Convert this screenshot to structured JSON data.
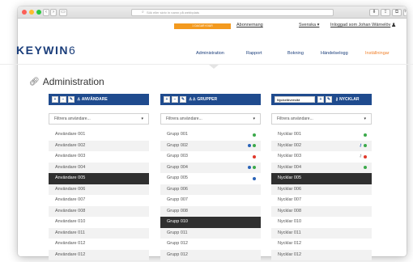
{
  "browser": {
    "url": "Sök eller skriv in namn på webbplats"
  },
  "topbar": {
    "cta": "1 DAGAR KVAR",
    "subscription": "Abonnemang",
    "language": "Svenska ▾",
    "logged_in": "Inloggad som Johan Wärnelöv"
  },
  "brand": {
    "logo_main": "KEYWIN",
    "logo_suffix": "6"
  },
  "nav": {
    "items": [
      {
        "label": "Administration"
      },
      {
        "label": "Rapport"
      },
      {
        "label": "Bokning"
      },
      {
        "label": "Händelselogg"
      },
      {
        "label": "Inställningar"
      }
    ]
  },
  "page": {
    "title": "Administration"
  },
  "users": {
    "title": "ANVÄNDARE",
    "filter_placeholder": "Filtrera användare...",
    "items": [
      "Användare 001",
      "Användare 002",
      "Användare 003",
      "Användare 004",
      "Användare 005",
      "Användare 006",
      "Användare 007",
      "Användare 008",
      "Användare 010",
      "Användare 011",
      "Användare 012",
      "Användare 012"
    ]
  },
  "groups": {
    "title": "GRUPPER",
    "filter_placeholder": "Filtrera användare...",
    "items": [
      "Grupp 001",
      "Grupp 002",
      "Grupp 003",
      "Grupp 004",
      "Grupp 005",
      "Grupp 006",
      "Grupp 007",
      "Grupp 008",
      "Grupp 010",
      "Grupp 011",
      "Grupp 012",
      "Grupp 012"
    ]
  },
  "keys": {
    "title": "NYCKLAR",
    "select_label": "Nyckelöversikt",
    "filter_placeholder": "Filtrera användare...",
    "items": [
      "Nycklar 001",
      "Nycklar 002",
      "Nycklar 003",
      "Nycklar 004",
      "Nycklar 005",
      "Nycklar 006",
      "Nycklar 007",
      "Nycklar 008",
      "Nycklar 010",
      "Nycklar 011",
      "Nycklar 012",
      "Nycklar 012"
    ]
  },
  "colors": {
    "header_blue": "#1f4b8e",
    "accent_orange": "#f0822d",
    "selected_row": "#2f2f2f"
  }
}
